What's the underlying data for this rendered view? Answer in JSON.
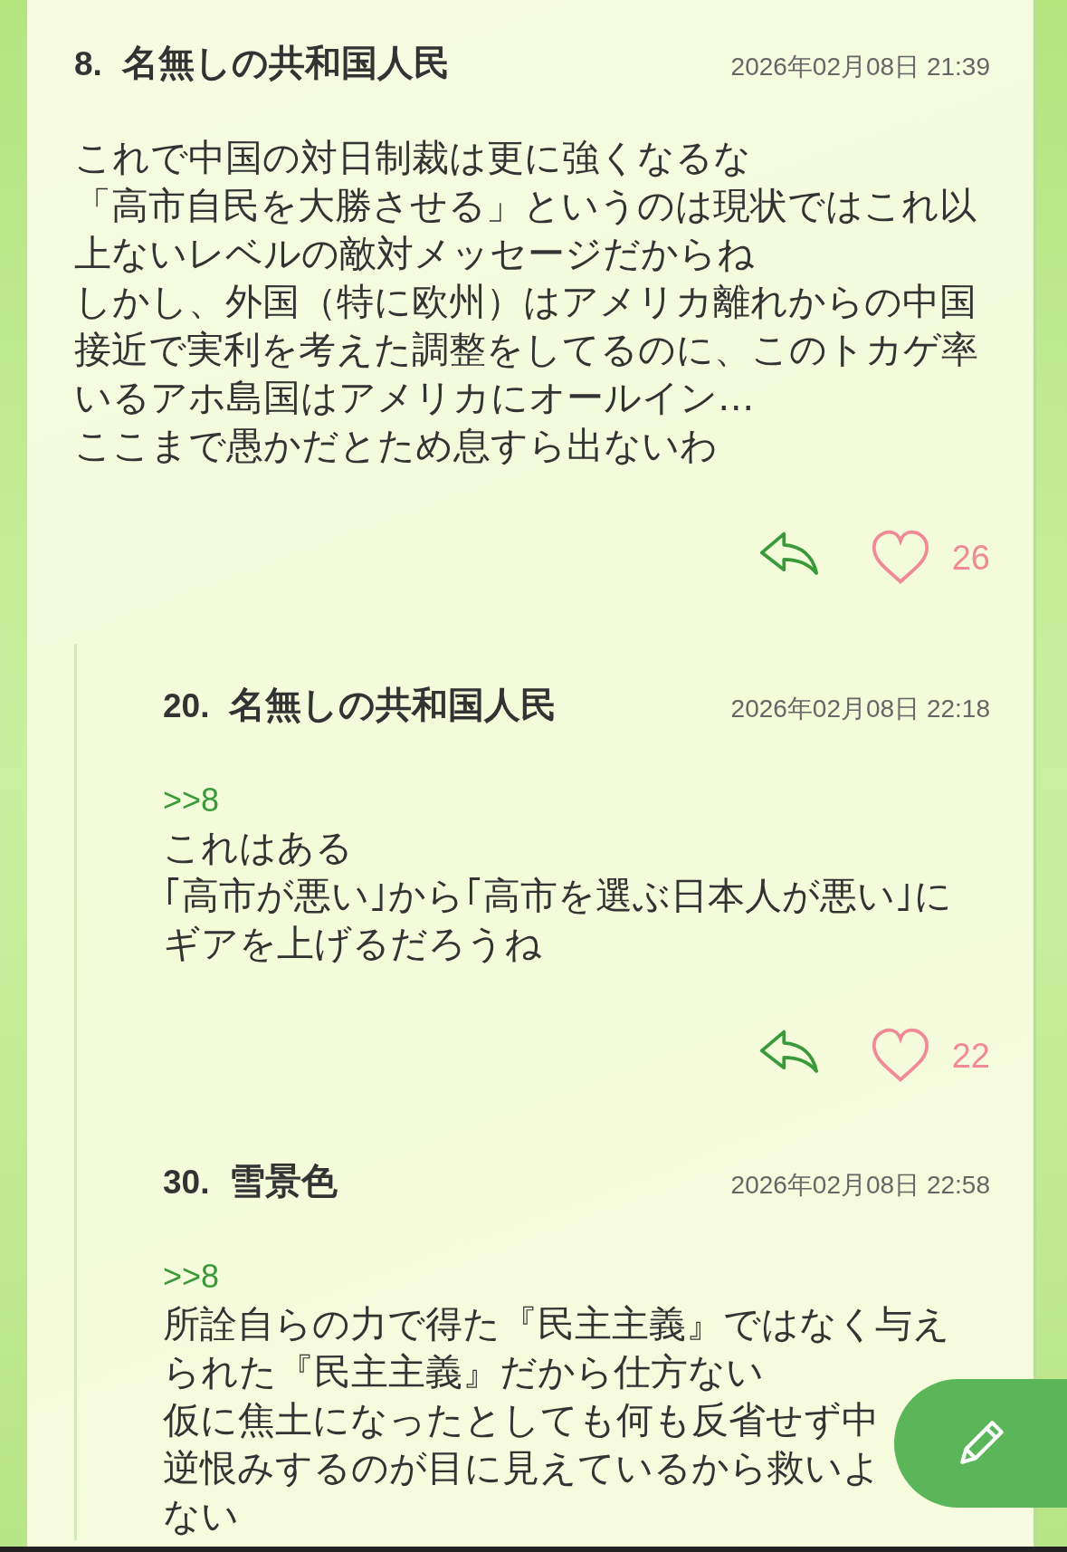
{
  "posts": [
    {
      "number": "8.",
      "name": "名無しの共和国人民",
      "date": "2026年02月08日 21:39",
      "body_lines": [
        "これで中国の対日制裁は更に強くなるな",
        "「高市自民を大勝させる」というのは現状ではこれ以",
        "上ないレベルの敵対メッセージだからね",
        "しかし、外国（特に欧州）はアメリカ離れからの中国",
        "接近で実利を考えた調整をしてるのに、このトカゲ率",
        "いるアホ島国はアメリカにオールイン…",
        "ここまで愚かだとため息すら出ないわ"
      ],
      "liked": false,
      "likes": "26",
      "replies": [
        {
          "number": "20.",
          "name": "名無しの共和国人民",
          "date": "2026年02月08日 22:18",
          "anchor": ">>8",
          "body_lines": [
            "これはある",
            "｢高市が悪い｣から｢高市を選ぶ日本人が悪い｣に",
            "ギアを上げるだろうね"
          ],
          "liked": false,
          "likes": "22"
        },
        {
          "number": "30.",
          "name": "雪景色",
          "date": "2026年02月08日 22:58",
          "anchor": ">>8",
          "body_lines": [
            "所詮自らの力で得た『民主主義』ではなく与え",
            "られた『民主主義』だから仕方ない",
            "仮に焦土になったとしても何も反省せず中",
            "逆恨みするのが目に見えているから救いよ",
            "ない"
          ]
        }
      ]
    }
  ]
}
